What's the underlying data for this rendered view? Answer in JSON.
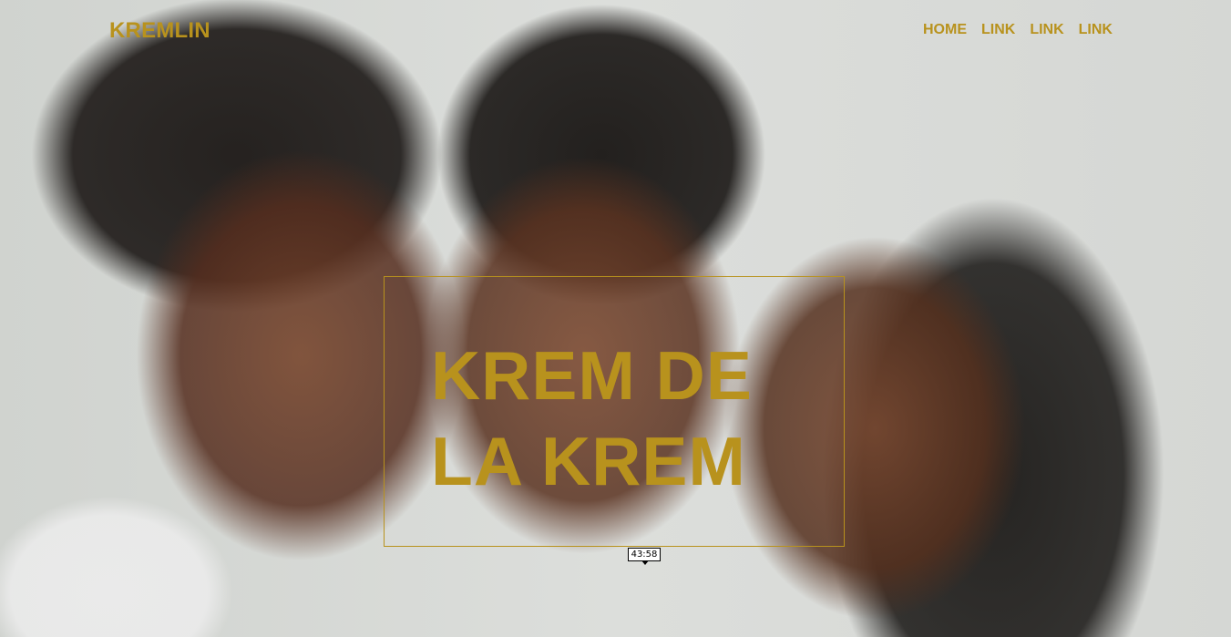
{
  "header": {
    "brand": "KREMLIN",
    "nav": [
      "HOME",
      "LINK",
      "LINK",
      "LINK"
    ]
  },
  "hero": {
    "headline_line1": "KREM DE",
    "headline_line2": "LA KREM",
    "tooltip": "43:58"
  },
  "colors": {
    "accent": "#b8921d",
    "background": "#d7d9d6"
  }
}
